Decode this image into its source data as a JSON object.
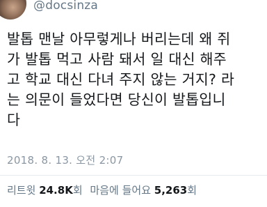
{
  "header": {
    "avatar_icon": "profile-photo",
    "handle": "@docsinza"
  },
  "tweet": {
    "lines": [
      "발톱 맨날 아무렇게나 버리는데 왜 쥐",
      "가 발톱 먹고 사람 돼서 일 대신 해주",
      "고 학교 대신 다녀 주지 않는 거지? 라",
      "는 의문이 들었다면 당신이 발톱입니",
      "다"
    ],
    "timestamp": "2018. 8. 13. 오전 2:07"
  },
  "stats": {
    "retweets_label": "리트윗",
    "retweets_count": "24.8K",
    "retweets_unit": "회",
    "likes_label": "마음에 들어요",
    "likes_count": "5,263",
    "likes_unit": "회"
  }
}
